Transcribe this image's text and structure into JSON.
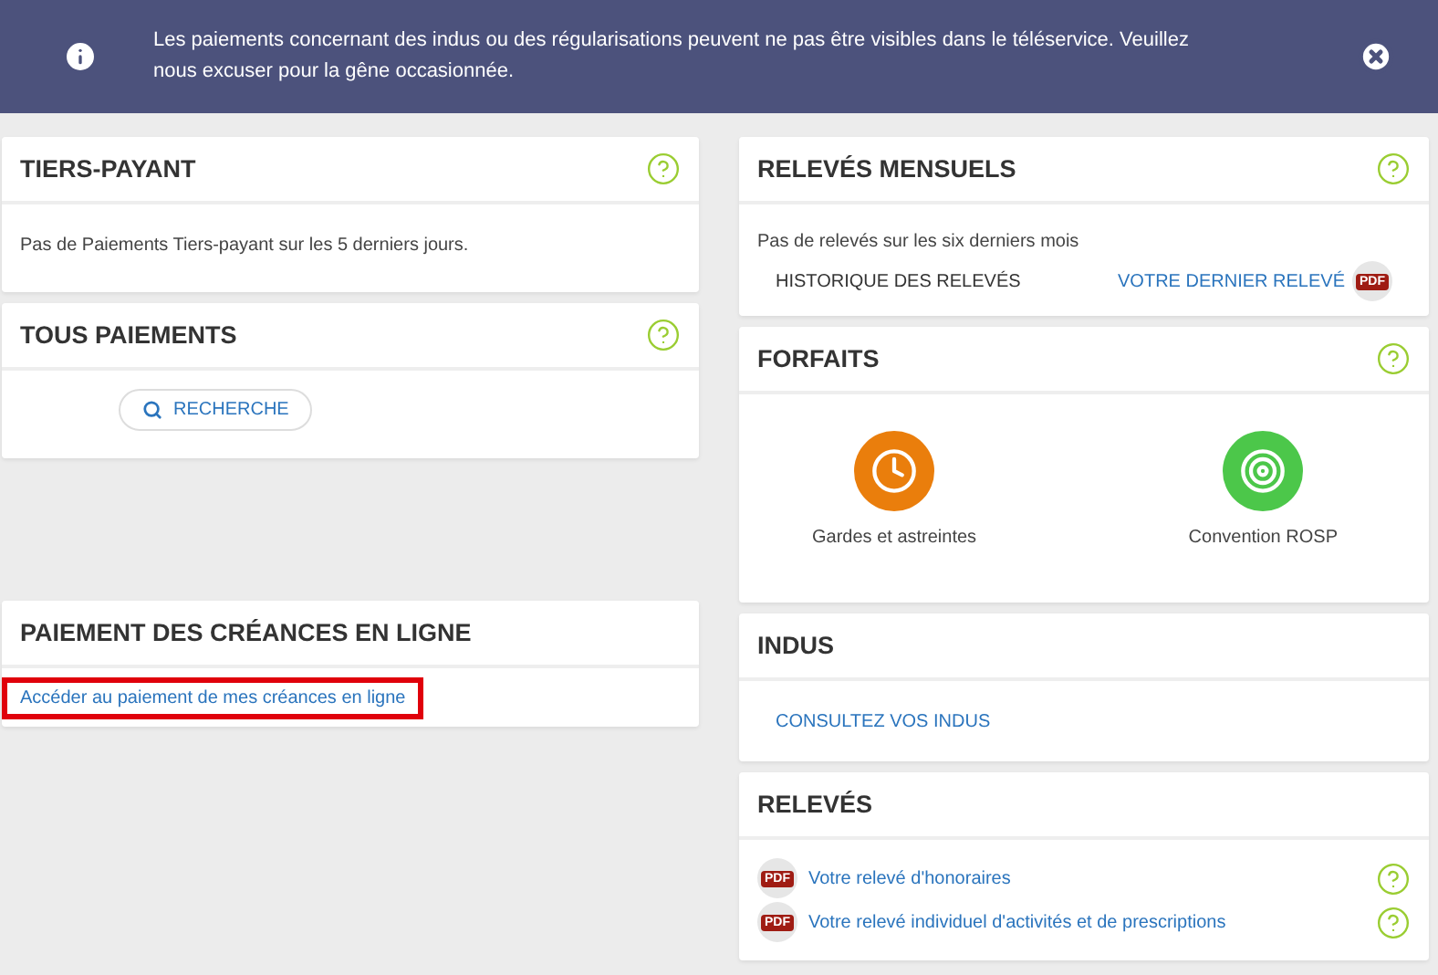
{
  "banner": {
    "message": "Les paiements concernant des indus ou des régularisations peuvent ne pas être visibles dans le téléservice. Veuillez nous excuser pour la gêne occasionnée."
  },
  "left_column": [
    {
      "kind": "text",
      "title": "TIERS-PAYANT",
      "help": true,
      "text": "Pas de Paiements Tiers-payant sur les 5 derniers jours."
    },
    {
      "kind": "search",
      "title": "TOUS PAIEMENTS",
      "help": true,
      "button": "RECHERCHE"
    },
    {
      "kind": "link",
      "title": "PAIEMENT DES CRÉANCES EN LIGNE",
      "help": false,
      "link": "Accéder au paiement de mes créances en ligne",
      "highlighted": true
    }
  ],
  "right_column": [
    {
      "kind": "monthly",
      "title": "RELEVÉS MENSUELS",
      "help": true,
      "text": "Pas de relevés sur les six derniers mois",
      "history": "HISTORIQUE DES RELEVÉS",
      "latest": "VOTRE DERNIER RELEVÉ",
      "badge": "PDF"
    },
    {
      "kind": "forfaits",
      "title": "FORFAITS",
      "help": true,
      "items": [
        {
          "label": "Gardes et astreintes",
          "color": "#ea7e0c"
        },
        {
          "label": "Convention ROSP",
          "color": "#4cc74a"
        }
      ]
    },
    {
      "kind": "link",
      "title": "INDUS",
      "help": false,
      "link": "CONSULTEZ VOS INDUS",
      "highlighted": false
    },
    {
      "kind": "docs",
      "title": "RELEVÉS",
      "help": false,
      "docs": [
        {
          "badge": "PDF",
          "label": "Votre relevé d'honoraires",
          "help": true
        },
        {
          "badge": "PDF",
          "label": "Votre relevé individuel d'activités et de prescriptions",
          "help": true
        }
      ]
    }
  ]
}
